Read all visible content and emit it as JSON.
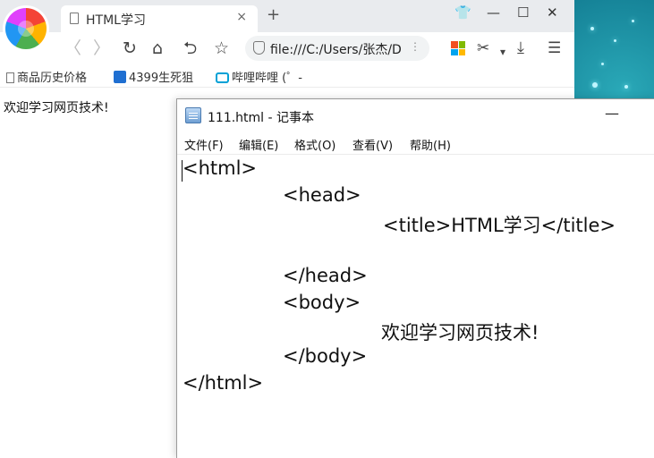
{
  "browser": {
    "tab_title": "HTML学习",
    "tab_close": "×",
    "new_tab": "+",
    "window_controls": {
      "skin": "👕",
      "minimize": "—",
      "maximize": "☐",
      "close": "✕"
    },
    "nav": {
      "back": "〈",
      "forward": "〉",
      "reload": "↻",
      "home": "⌂",
      "undo": "⮌",
      "favorite": "☆"
    },
    "address": {
      "url": "file:///C:/Users/张杰/D",
      "more": "⋮"
    },
    "right_tools": {
      "cut": "✂",
      "dropdown": "▾",
      "download": "⤓",
      "menu": "☰"
    },
    "bookmarks": [
      {
        "label": "商品历史价格",
        "icon": "page-icon"
      },
      {
        "label": "4399生死狙",
        "icon": "4399-icon"
      },
      {
        "label": "哔哩哔哩 (゜-",
        "icon": "bilibili-icon"
      }
    ],
    "page_text": "欢迎学习网页技术!"
  },
  "notepad": {
    "title": "111.html - 记事本",
    "minimize": "—",
    "menu": [
      "文件(F)",
      "编辑(E)",
      "格式(O)",
      "查看(V)",
      "帮助(H)"
    ],
    "lines": [
      "<html>",
      "<head>",
      "<title>HTML学习</title>",
      "",
      "</head>",
      "<body>",
      "欢迎学习网页技术!",
      "</body>",
      "</html>"
    ]
  },
  "colors": {
    "tabbar_bg": "#e9ebee",
    "desktop_teal": "#0b6f87",
    "bookmark_blue": "#1f6fd1",
    "bilibili_blue": "#00a1d6"
  }
}
